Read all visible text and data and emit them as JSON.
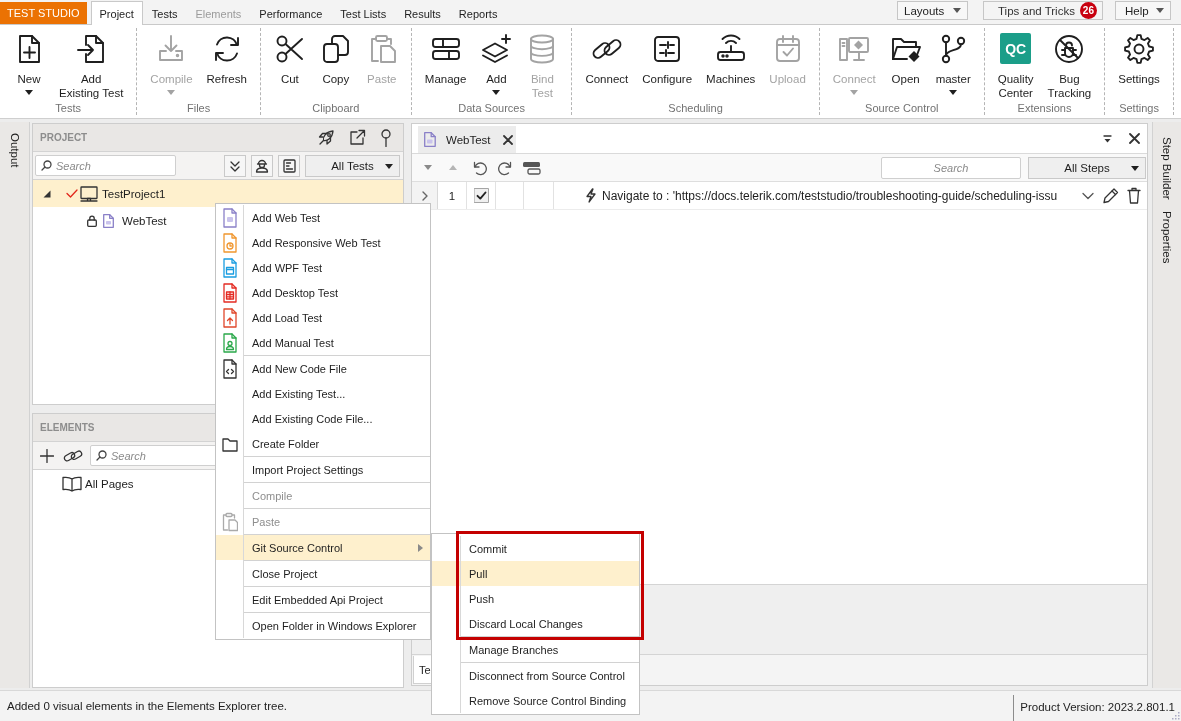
{
  "top_bar": {
    "app_menu": "TEST STUDIO",
    "tabs": [
      {
        "label": "Project",
        "selected": true,
        "disabled": false
      },
      {
        "label": "Tests",
        "selected": false,
        "disabled": false
      },
      {
        "label": "Elements",
        "selected": false,
        "disabled": true
      },
      {
        "label": "Performance",
        "selected": false,
        "disabled": false
      },
      {
        "label": "Test Lists",
        "selected": false,
        "disabled": false
      },
      {
        "label": "Results",
        "selected": false,
        "disabled": false
      },
      {
        "label": "Reports",
        "selected": false,
        "disabled": false
      }
    ],
    "layouts_menu": {
      "label": "Layouts"
    },
    "tips_button": {
      "label": "Tips and Tricks",
      "count": "26"
    },
    "help_menu": {
      "label": "Help"
    }
  },
  "ribbon": {
    "groups": [
      {
        "label": "Tests",
        "buttons": [
          {
            "label": "New",
            "disabled": false,
            "dropdown": true
          },
          {
            "label": "Add\nExisting Test",
            "disabled": false,
            "dropdown": false
          }
        ]
      },
      {
        "label": "Files",
        "buttons": [
          {
            "label": "Compile",
            "disabled": true,
            "dropdown": true
          },
          {
            "label": "Refresh",
            "disabled": false,
            "dropdown": false
          }
        ]
      },
      {
        "label": "Clipboard",
        "buttons": [
          {
            "label": "Cut",
            "disabled": false,
            "dropdown": false
          },
          {
            "label": "Copy",
            "disabled": false,
            "dropdown": false
          },
          {
            "label": "Paste",
            "disabled": true,
            "dropdown": false
          }
        ]
      },
      {
        "label": "Data Sources",
        "buttons": [
          {
            "label": "Manage",
            "disabled": false,
            "dropdown": false
          },
          {
            "label": "Add",
            "disabled": false,
            "dropdown": true
          },
          {
            "label": "Bind\nTest",
            "disabled": true,
            "dropdown": false
          }
        ]
      },
      {
        "label": "Scheduling",
        "buttons": [
          {
            "label": "Connect",
            "disabled": false,
            "dropdown": false
          },
          {
            "label": "Configure",
            "disabled": false,
            "dropdown": false
          },
          {
            "label": "Machines",
            "disabled": false,
            "dropdown": false
          },
          {
            "label": "Upload",
            "disabled": true,
            "dropdown": false
          }
        ]
      },
      {
        "label": "Source Control",
        "buttons": [
          {
            "label": "Connect",
            "disabled": true,
            "dropdown": true
          },
          {
            "label": "Open",
            "disabled": false,
            "dropdown": false
          },
          {
            "label": "master",
            "disabled": false,
            "dropdown": true
          }
        ]
      },
      {
        "label": "Extensions",
        "buttons": [
          {
            "label": "Quality\nCenter",
            "logo": "QC",
            "disabled": false,
            "dropdown": false
          },
          {
            "label": "Bug\nTracking",
            "disabled": false,
            "dropdown": false
          }
        ]
      },
      {
        "label": "Settings",
        "buttons": [
          {
            "label": "Settings",
            "disabled": false,
            "dropdown": false
          }
        ]
      }
    ]
  },
  "left_panes": [
    {
      "label": "Output"
    }
  ],
  "project_panel": {
    "title": "PROJECT",
    "search": {
      "placeholder": "Search"
    },
    "filter": {
      "value": "All Tests"
    },
    "tree": [
      {
        "label": "TestProject1",
        "kind": "project",
        "selected": true,
        "expanded": true,
        "checked_out": true,
        "locked": false,
        "children": [
          {
            "label": "WebTest",
            "kind": "web-test",
            "selected": false,
            "checked_out": false,
            "locked": true
          }
        ]
      }
    ]
  },
  "elements_panel": {
    "title": "ELEMENTS",
    "search": {
      "placeholder": "Search"
    },
    "tree": [
      {
        "label": "All Pages"
      }
    ]
  },
  "document": {
    "tabs": [
      {
        "label": "WebTest",
        "selected": true
      }
    ],
    "search": {
      "placeholder": "Search"
    },
    "filter": {
      "value": "All Steps"
    },
    "steps": [
      {
        "number": "1",
        "expanded": false,
        "checked": true,
        "description": "Navigate to : 'https://docs.telerik.com/teststudio/troubleshooting-guide/scheduling-issu"
      }
    ],
    "bottom_tabs": [
      {
        "label": "Te"
      }
    ]
  },
  "right_panes": [
    {
      "label": "Step Builder"
    },
    {
      "label": "Properties"
    }
  ],
  "context_menu": {
    "groups": [
      {
        "items": [
          {
            "label": "Add Web Test",
            "kind": "web",
            "disabled": false,
            "highlighted": false
          },
          {
            "label": "Add Responsive Web Test",
            "kind": "responsive",
            "disabled": false,
            "highlighted": false
          },
          {
            "label": "Add WPF Test",
            "kind": "wpf",
            "disabled": false,
            "highlighted": false
          },
          {
            "label": "Add Desktop Test",
            "kind": "desktop",
            "disabled": false,
            "highlighted": false
          },
          {
            "label": "Add Load Test",
            "kind": "load",
            "disabled": false,
            "highlighted": false
          },
          {
            "label": "Add Manual Test",
            "kind": "manual",
            "disabled": false,
            "highlighted": false
          }
        ]
      },
      {
        "items": [
          {
            "label": "Add New Code File",
            "kind": "code",
            "disabled": false,
            "highlighted": false
          },
          {
            "label": "Add Existing Test...",
            "kind": "plain",
            "disabled": false,
            "highlighted": false
          },
          {
            "label": "Add Existing Code File...",
            "kind": "plain",
            "disabled": false,
            "highlighted": false
          },
          {
            "label": "Create Folder",
            "kind": "folder",
            "disabled": false,
            "highlighted": false
          }
        ]
      },
      {
        "items": [
          {
            "label": "Import Project Settings",
            "kind": "plain",
            "disabled": false,
            "highlighted": false
          }
        ]
      },
      {
        "items": [
          {
            "label": "Compile",
            "kind": "plain",
            "disabled": true,
            "highlighted": false
          }
        ]
      },
      {
        "items": [
          {
            "label": "Paste",
            "kind": "paste",
            "disabled": true,
            "highlighted": false
          }
        ]
      },
      {
        "items": [
          {
            "label": "Git Source Control",
            "kind": "plain",
            "disabled": false,
            "highlighted": true,
            "submenu": {
              "groups": [
                {
                  "items": [
                    {
                      "label": "Commit",
                      "highlighted": false,
                      "annotated": true
                    },
                    {
                      "label": "Pull",
                      "highlighted": true,
                      "annotated": true
                    },
                    {
                      "label": "Push",
                      "highlighted": false,
                      "annotated": true
                    },
                    {
                      "label": "Discard Local Changes",
                      "highlighted": false,
                      "annotated": true
                    }
                  ]
                },
                {
                  "items": [
                    {
                      "label": "Manage Branches",
                      "highlighted": false,
                      "annotated": false
                    }
                  ]
                },
                {
                  "items": [
                    {
                      "label": "Disconnect from Source Control",
                      "highlighted": false,
                      "annotated": false
                    },
                    {
                      "label": "Remove Source Control Binding",
                      "highlighted": false,
                      "annotated": false
                    }
                  ]
                }
              ]
            }
          }
        ]
      },
      {
        "items": [
          {
            "label": "Close Project",
            "kind": "plain",
            "disabled": false,
            "highlighted": false
          }
        ]
      },
      {
        "items": [
          {
            "label": "Edit Embedded Api Project",
            "kind": "plain",
            "disabled": false,
            "highlighted": false
          }
        ]
      },
      {
        "items": [
          {
            "label": "Open Folder in Windows Explorer",
            "kind": "plain",
            "disabled": false,
            "highlighted": false
          }
        ]
      }
    ]
  },
  "status_bar": {
    "message": "Added 0 visual elements in the Elements Explorer tree.",
    "version": "Product Version: 2023.2.801.1"
  }
}
